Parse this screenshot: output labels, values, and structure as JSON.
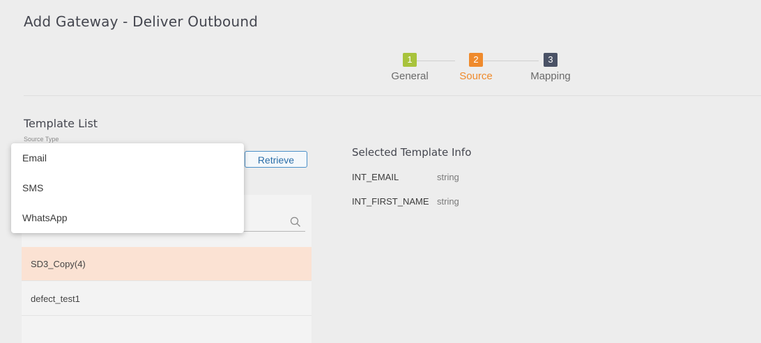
{
  "page": {
    "title": "Add Gateway - Deliver Outbound"
  },
  "stepper": {
    "steps": [
      {
        "number": "1",
        "label": "General",
        "color": "#a8c33c",
        "active": false
      },
      {
        "number": "2",
        "label": "Source",
        "color": "#ef8a2c",
        "active": true
      },
      {
        "number": "3",
        "label": "Mapping",
        "color": "#4a5266",
        "active": false
      }
    ]
  },
  "template_list": {
    "title": "Template List",
    "source_type_label": "Source Type",
    "retrieve_label": "Retrieve",
    "search": {
      "value": "",
      "placeholder": ""
    },
    "items": [
      {
        "name": "SD3_Copy(4)",
        "selected": true
      },
      {
        "name": "defect_test1",
        "selected": false
      }
    ]
  },
  "source_type_dropdown": {
    "options": [
      "Email",
      "SMS",
      "WhatsApp"
    ]
  },
  "template_info": {
    "title": "Selected Template Info",
    "fields": [
      {
        "name": "INT_EMAIL",
        "type": "string"
      },
      {
        "name": "INT_FIRST_NAME",
        "type": "string"
      }
    ]
  },
  "colors": {
    "accent": "#ef8a2c",
    "selected_row": "#fbe2d3",
    "button_border": "#4a90c8"
  }
}
